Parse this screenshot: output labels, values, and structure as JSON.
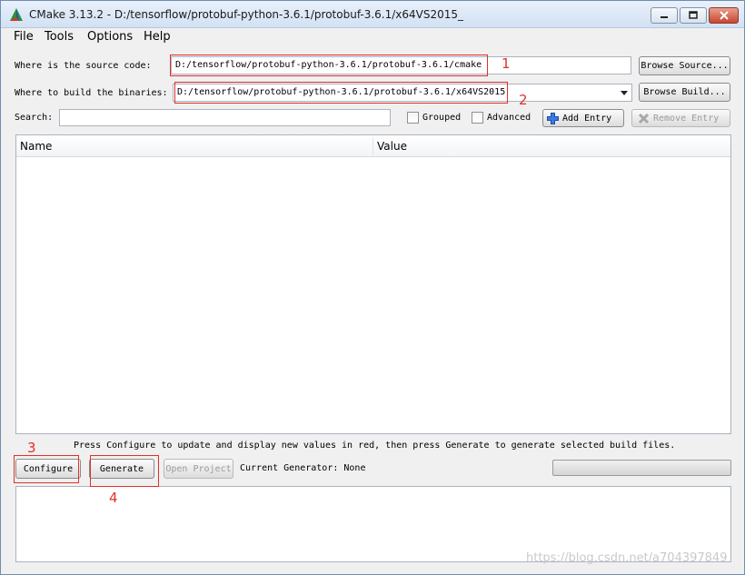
{
  "window": {
    "title": "CMake 3.13.2 - D:/tensorflow/protobuf-python-3.6.1/protobuf-3.6.1/x64VS2015_",
    "icon": "cmake-triangle-icon",
    "controls": [
      "minimize-icon",
      "maximize-icon",
      "close-icon"
    ]
  },
  "menu": {
    "items": [
      {
        "label": "File"
      },
      {
        "label": "Tools"
      },
      {
        "label": "Options"
      },
      {
        "label": "Help"
      }
    ]
  },
  "source": {
    "label": "Where is the source code:",
    "value": "D:/tensorflow/protobuf-python-3.6.1/protobuf-3.6.1/cmake",
    "browse_label": "Browse Source..."
  },
  "build": {
    "label": "Where to build the binaries:",
    "value": "D:/tensorflow/protobuf-python-3.6.1/protobuf-3.6.1/x64VS2015",
    "browse_label": "Browse Build..."
  },
  "search": {
    "label": "Search:",
    "value": "",
    "grouped_label": "Grouped",
    "grouped_checked": false,
    "advanced_label": "Advanced",
    "advanced_checked": false,
    "add_entry_label": "Add Entry",
    "remove_entry_label": "Remove Entry"
  },
  "table": {
    "columns": [
      "Name",
      "Value"
    ],
    "rows": []
  },
  "hint": "Press Configure to update and display new values in red,  then press Generate to generate selected build files.",
  "actions": {
    "configure_label": "Configure",
    "generate_label": "Generate",
    "open_project_label": "Open Project",
    "generator_text": "Current Generator: None"
  },
  "annotations": [
    "1",
    "2",
    "3",
    "4"
  ],
  "annotation_color": "#e0302a",
  "watermark": "https://blog.csdn.net/a704397849"
}
